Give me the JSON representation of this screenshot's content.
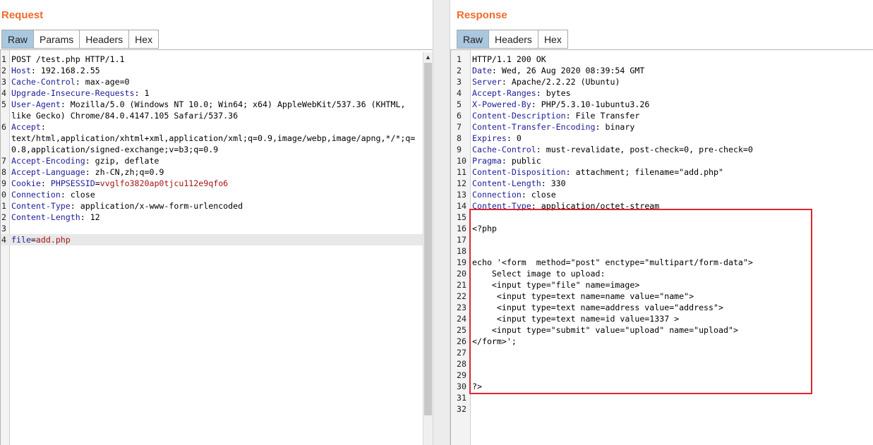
{
  "request": {
    "title": "Request",
    "tabs": [
      "Raw",
      "Params",
      "Headers",
      "Hex"
    ],
    "active_tab": "Raw",
    "lines": [
      {
        "n": "1",
        "name": "",
        "sep": "",
        "value": "POST /test.php HTTP/1.1"
      },
      {
        "n": "2",
        "name": "Host",
        "sep": ": ",
        "value": "192.168.2.55"
      },
      {
        "n": "3",
        "name": "Cache-Control",
        "sep": ": ",
        "value": "max-age=0"
      },
      {
        "n": "4",
        "name": "Upgrade-Insecure-Requests",
        "sep": ": ",
        "value": "1"
      },
      {
        "n": "5",
        "name": "User-Agent",
        "sep": ": ",
        "value": "Mozilla/5.0 (Windows NT 10.0; Win64; x64) AppleWebKit/537.36 (KHTML,"
      },
      {
        "n": "",
        "name": "",
        "sep": "",
        "value": "like Gecko) Chrome/84.0.4147.105 Safari/537.36"
      },
      {
        "n": "6",
        "name": "Accept",
        "sep": ":",
        "value": ""
      },
      {
        "n": "",
        "name": "",
        "sep": "",
        "value": "text/html,application/xhtml+xml,application/xml;q=0.9,image/webp,image/apng,*/*;q="
      },
      {
        "n": "",
        "name": "",
        "sep": "",
        "value": "0.8,application/signed-exchange;v=b3;q=0.9"
      },
      {
        "n": "7",
        "name": "Accept-Encoding",
        "sep": ": ",
        "value": "gzip, deflate"
      },
      {
        "n": "8",
        "name": "Accept-Language",
        "sep": ": ",
        "value": "zh-CN,zh;q=0.9"
      },
      {
        "n": "9",
        "name": "Cookie",
        "sep": ": ",
        "cookie_name": "PHPSESSID",
        "cookie_value": "vvglfo3820ap0tjcu112e9qfo6"
      },
      {
        "n": "0",
        "name": "Connection",
        "sep": ": ",
        "value": "close"
      },
      {
        "n": "1",
        "name": "Content-Type",
        "sep": ": ",
        "value": "application/x-www-form-urlencoded"
      },
      {
        "n": "2",
        "name": "Content-Length",
        "sep": ": ",
        "value": "12"
      },
      {
        "n": "3",
        "name": "",
        "sep": "",
        "value": ""
      },
      {
        "n": "4",
        "param_name": "file",
        "param_value": "add.php",
        "highlight": true
      }
    ]
  },
  "response": {
    "title": "Response",
    "tabs": [
      "Raw",
      "Headers",
      "Hex"
    ],
    "active_tab": "Raw",
    "lines": [
      {
        "n": "1",
        "name": "",
        "sep": "",
        "value": "HTTP/1.1 200 OK"
      },
      {
        "n": "2",
        "name": "Date",
        "sep": ": ",
        "value": "Wed, 26 Aug 2020 08:39:54 GMT"
      },
      {
        "n": "3",
        "name": "Server",
        "sep": ": ",
        "value": "Apache/2.2.22 (Ubuntu)"
      },
      {
        "n": "4",
        "name": "Accept-Ranges",
        "sep": ": ",
        "value": "bytes"
      },
      {
        "n": "5",
        "name": "X-Powered-By",
        "sep": ": ",
        "value": "PHP/5.3.10-1ubuntu3.26"
      },
      {
        "n": "6",
        "name": "Content-Description",
        "sep": ": ",
        "value": "File Transfer"
      },
      {
        "n": "7",
        "name": "Content-Transfer-Encoding",
        "sep": ": ",
        "value": "binary"
      },
      {
        "n": "8",
        "name": "Expires",
        "sep": ": ",
        "value": "0"
      },
      {
        "n": "9",
        "name": "Cache-Control",
        "sep": ": ",
        "value": "must-revalidate, post-check=0, pre-check=0"
      },
      {
        "n": "10",
        "name": "Pragma",
        "sep": ": ",
        "value": "public"
      },
      {
        "n": "11",
        "name": "Content-Disposition",
        "sep": ": ",
        "value": "attachment; filename=\"add.php\""
      },
      {
        "n": "12",
        "name": "Content-Length",
        "sep": ": ",
        "value": "330"
      },
      {
        "n": "13",
        "name": "Connection",
        "sep": ": ",
        "value": "close"
      },
      {
        "n": "14",
        "name": "Content-Type",
        "sep": ": ",
        "value": "application/octet-stream"
      },
      {
        "n": "15",
        "name": "",
        "sep": "",
        "value": ""
      },
      {
        "n": "16",
        "name": "",
        "sep": "",
        "value": "<?php"
      },
      {
        "n": "17",
        "name": "",
        "sep": "",
        "value": ""
      },
      {
        "n": "18",
        "name": "",
        "sep": "",
        "value": ""
      },
      {
        "n": "19",
        "name": "",
        "sep": "",
        "value": "echo '<form  method=\"post\" enctype=\"multipart/form-data\">"
      },
      {
        "n": "20",
        "name": "",
        "sep": "",
        "value": "    Select image to upload:"
      },
      {
        "n": "21",
        "name": "",
        "sep": "",
        "value": "    <input type=\"file\" name=image>"
      },
      {
        "n": "22",
        "name": "",
        "sep": "",
        "value": "     <input type=text name=name value=\"name\">"
      },
      {
        "n": "23",
        "name": "",
        "sep": "",
        "value": "     <input type=text name=address value=\"address\">"
      },
      {
        "n": "24",
        "name": "",
        "sep": "",
        "value": "     <input type=text name=id value=1337 >"
      },
      {
        "n": "25",
        "name": "",
        "sep": "",
        "value": "    <input type=\"submit\" value=\"upload\" name=\"upload\">"
      },
      {
        "n": "26",
        "name": "",
        "sep": "",
        "value": "</form>';"
      },
      {
        "n": "27",
        "name": "",
        "sep": "",
        "value": ""
      },
      {
        "n": "28",
        "name": "",
        "sep": "",
        "value": ""
      },
      {
        "n": "29",
        "name": "",
        "sep": "",
        "value": ""
      },
      {
        "n": "30",
        "name": "",
        "sep": "",
        "value": "?>"
      },
      {
        "n": "31",
        "name": "",
        "sep": "",
        "value": ""
      },
      {
        "n": "32",
        "name": "",
        "sep": "",
        "value": ""
      }
    ]
  },
  "icons": {
    "scroll_up": "scroll-up-arrow-icon"
  },
  "colors": {
    "title": "#f26a2d",
    "active_tab": "#a9c7df",
    "header_name": "#1d1d9a",
    "param_value": "#a31515",
    "highlight_box": "#e0262e"
  }
}
